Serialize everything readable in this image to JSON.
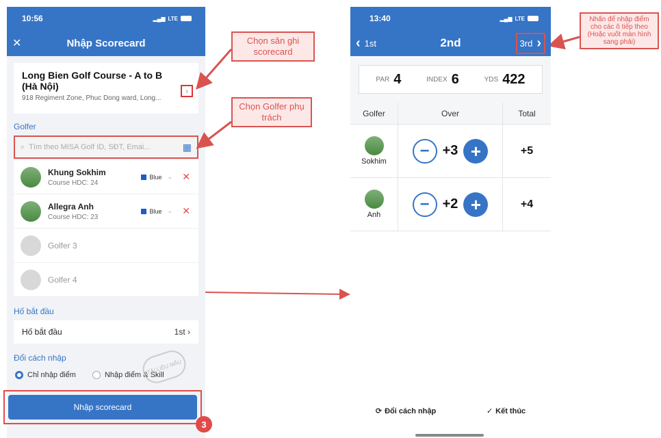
{
  "left_screen": {
    "status": {
      "time": "10:56",
      "network": "LTE"
    },
    "nav": {
      "close_icon": "close-icon",
      "title": "Nhập Scorecard"
    },
    "course": {
      "name": "Long Bien Golf Course - A to B (Hà Nội)",
      "address": "918 Regiment Zone, Phuc Dong ward, Long...",
      "chevron": "›"
    },
    "golfer_section_label": "Golfer",
    "search": {
      "placeholder": "Tìm theo MISA Golf ID, SĐT, Emai..."
    },
    "golfers": [
      {
        "name": "Khung Sokhim",
        "hdc": "Course HDC: 24",
        "tee": "Blue"
      },
      {
        "name": "Allegra Anh",
        "hdc": "Course HDC: 23",
        "tee": "Blue"
      }
    ],
    "placeholders": [
      "Golfer 3",
      "Golfer 4"
    ],
    "start_hole": {
      "section_label": "Hố bắt đầu",
      "label": "Hố bắt đầu",
      "value": "1st"
    },
    "input_mode": {
      "section_label": "Đổi cách nhập",
      "option1": "Chỉ nhập điểm",
      "option2": "Nhập điểm & Skill"
    },
    "watermark": "TÀI LIỆU MẪU",
    "submit_label": "Nhập scorecard",
    "step_badge": "3"
  },
  "callouts": {
    "course": "Chọn sân ghi scorecard",
    "golfer": "Chọn Golfer phụ trách",
    "next_hole": "Nhấn để nhập điểm cho các ô tiếp theo (Hoặc vuốt màn hình sang phải)"
  },
  "right_screen": {
    "status": {
      "time": "13:40",
      "network": "LTE"
    },
    "nav": {
      "prev": "1st",
      "current": "2nd",
      "next": "3rd"
    },
    "hole_info": {
      "par_label": "PAR",
      "par": "4",
      "index_label": "INDEX",
      "index": "6",
      "yds_label": "YDS",
      "yds": "422"
    },
    "table_headers": {
      "golfer": "Golfer",
      "over": "Over",
      "total": "Total"
    },
    "scores": [
      {
        "golfer": "Sokhim",
        "over": "+3",
        "total": "+5"
      },
      {
        "golfer": "Anh",
        "over": "+2",
        "total": "+4"
      }
    ],
    "footer": {
      "switch_input": "Đổi cách nhập",
      "finish": "Kết thúc"
    }
  },
  "colors": {
    "primary": "#3674c6",
    "annotation": "#d9534f"
  }
}
